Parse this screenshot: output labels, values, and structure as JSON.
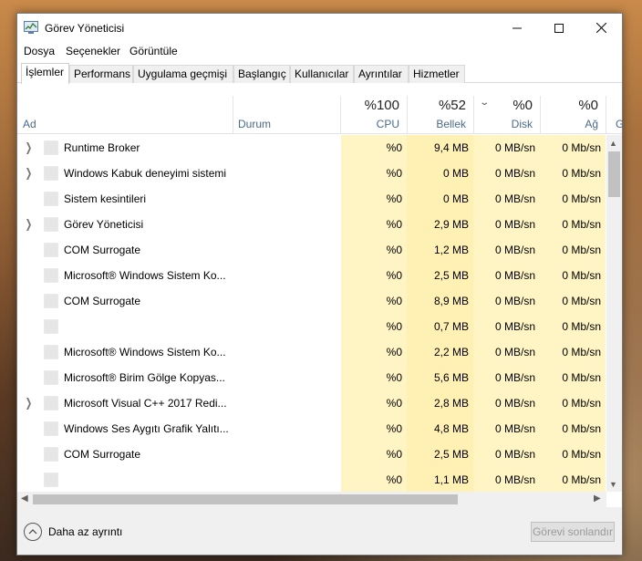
{
  "window": {
    "title": "Görev Yöneticisi"
  },
  "menu": [
    "Dosya",
    "Seçenekler",
    "Görüntüle"
  ],
  "tabs": [
    "İşlemler",
    "Performans",
    "Uygulama geçmişi",
    "Başlangıç",
    "Kullanıcılar",
    "Ayrıntılar",
    "Hizmetler"
  ],
  "active_tab": "İşlemler",
  "columns": {
    "name": "Ad",
    "status": "Durum",
    "cpu": {
      "pct": "%100",
      "label": "CPU"
    },
    "mem": {
      "pct": "%52",
      "label": "Bellek"
    },
    "disk": {
      "pct": "%0",
      "label": "Disk"
    },
    "net": {
      "pct": "%0",
      "label": "Ağ"
    },
    "cut_off": "G"
  },
  "rows": [
    {
      "expandable": true,
      "name": "Runtime Broker",
      "cpu": "%0",
      "mem": "9,4 MB",
      "disk": "0 MB/sn",
      "net": "0 Mb/sn"
    },
    {
      "expandable": true,
      "name": "Windows Kabuk deneyimi sistemi",
      "cpu": "%0",
      "mem": "0 MB",
      "disk": "0 MB/sn",
      "net": "0 Mb/sn"
    },
    {
      "expandable": false,
      "name": "Sistem kesintileri",
      "cpu": "%0",
      "mem": "0 MB",
      "disk": "0 MB/sn",
      "net": "0 Mb/sn"
    },
    {
      "expandable": true,
      "name": "Görev Yöneticisi",
      "cpu": "%0",
      "mem": "2,9 MB",
      "disk": "0 MB/sn",
      "net": "0 Mb/sn"
    },
    {
      "expandable": false,
      "name": "COM Surrogate",
      "cpu": "%0",
      "mem": "1,2 MB",
      "disk": "0 MB/sn",
      "net": "0 Mb/sn"
    },
    {
      "expandable": false,
      "name": "Microsoft® Windows Sistem Ko...",
      "cpu": "%0",
      "mem": "2,5 MB",
      "disk": "0 MB/sn",
      "net": "0 Mb/sn"
    },
    {
      "expandable": false,
      "name": "COM Surrogate",
      "cpu": "%0",
      "mem": "8,9 MB",
      "disk": "0 MB/sn",
      "net": "0 Mb/sn"
    },
    {
      "expandable": false,
      "name": "",
      "cpu": "%0",
      "mem": "0,7 MB",
      "disk": "0 MB/sn",
      "net": "0 Mb/sn"
    },
    {
      "expandable": false,
      "name": "Microsoft® Windows Sistem Ko...",
      "cpu": "%0",
      "mem": "2,2 MB",
      "disk": "0 MB/sn",
      "net": "0 Mb/sn"
    },
    {
      "expandable": false,
      "name": "Microsoft® Birim Gölge Kopyas...",
      "cpu": "%0",
      "mem": "5,6 MB",
      "disk": "0 MB/sn",
      "net": "0 Mb/sn"
    },
    {
      "expandable": true,
      "name": "Microsoft Visual C++ 2017 Redi...",
      "cpu": "%0",
      "mem": "2,8 MB",
      "disk": "0 MB/sn",
      "net": "0 Mb/sn"
    },
    {
      "expandable": false,
      "name": "Windows Ses Aygıtı Grafik Yalıtı...",
      "cpu": "%0",
      "mem": "4,8 MB",
      "disk": "0 MB/sn",
      "net": "0 Mb/sn"
    },
    {
      "expandable": false,
      "name": "COM Surrogate",
      "cpu": "%0",
      "mem": "2,5 MB",
      "disk": "0 MB/sn",
      "net": "0 Mb/sn"
    },
    {
      "expandable": false,
      "name": "",
      "cpu": "%0",
      "mem": "1,1 MB",
      "disk": "0 MB/sn",
      "net": "0 Mb/sn"
    }
  ],
  "footer": {
    "less_details": "Daha az ayrıntı",
    "end_task": "Görevi sonlandır"
  },
  "colors": {
    "cpu_bg": "#fff4c4",
    "mem_bg": "#fff0b4",
    "header_label": "#4a6a8a"
  },
  "icons": [
    "task-manager-app-icon",
    "minimize-icon",
    "maximize-icon",
    "close-icon",
    "expand-chevron-icon",
    "process-icon",
    "sort-down-icon",
    "collapse-up-circle-icon"
  ]
}
